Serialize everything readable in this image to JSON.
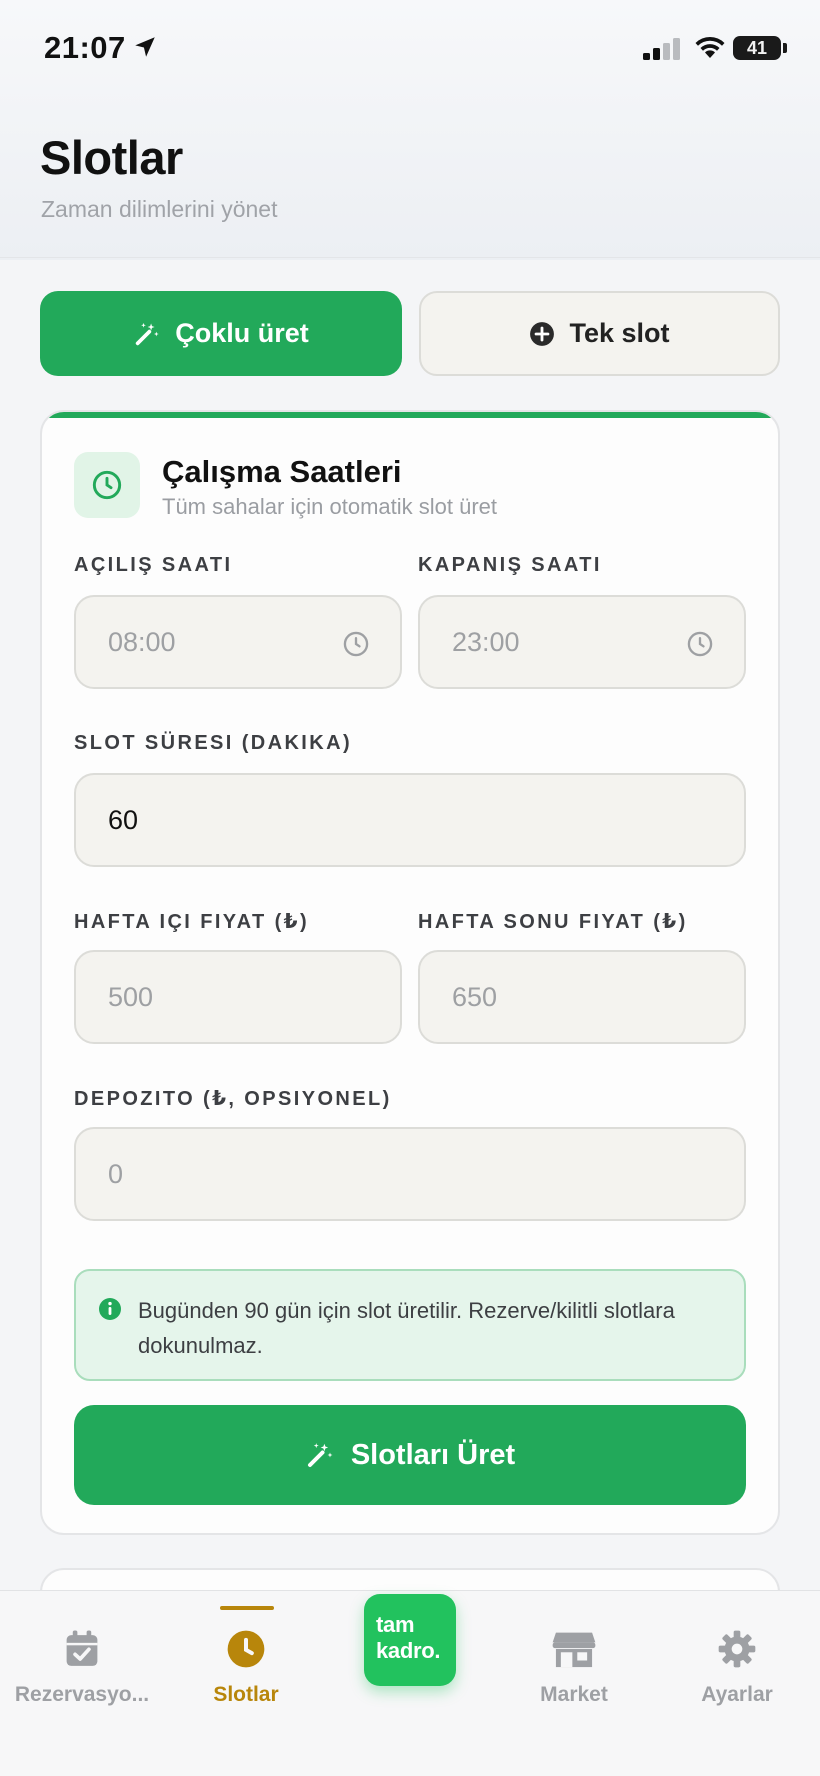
{
  "status_bar": {
    "time": "21:07",
    "battery": "41"
  },
  "header": {
    "title": "Slotlar",
    "subtitle": "Zaman dilimlerini yönet"
  },
  "mode_toggle": {
    "bulk_label": "Çoklu üret",
    "single_label": "Tek slot",
    "active": "bulk"
  },
  "card": {
    "title": "Çalışma Saatleri",
    "subtitle": "Tüm sahalar için otomatik slot üret",
    "opening": {
      "label": "AÇILIŞ SAATI",
      "placeholder": "08:00"
    },
    "closing": {
      "label": "KAPANIŞ SAATI",
      "placeholder": "23:00"
    },
    "slot_duration": {
      "label": "SLOT SÜRESI (DAKIKA)",
      "value": "60"
    },
    "weekday_price": {
      "label": "HAFTA IÇI FIYAT (₺)",
      "placeholder": "500"
    },
    "weekend_price": {
      "label": "HAFTA SONU FIYAT (₺)",
      "placeholder": "650"
    },
    "deposit": {
      "label": "DEPOZITO (₺, OPSIYONEL)",
      "placeholder": "0"
    },
    "info": "Bugünden 90 gün için slot üretilir. Rezerve/kilitli slotlara dokunulmaz.",
    "submit_label": "Slotları Üret"
  },
  "tabbar": {
    "items": [
      {
        "label": "Rezervasyo...",
        "icon": "calendar-check-icon"
      },
      {
        "label": "Slotlar",
        "icon": "clock-icon",
        "active": true
      },
      {
        "label": "Market",
        "icon": "store-icon"
      },
      {
        "label": "Ayarlar",
        "icon": "gear-icon"
      }
    ],
    "logo_line1": "tam",
    "logo_line2": "kadro."
  },
  "colors": {
    "primary": "#22a95a",
    "active_tab": "#b8860b",
    "info_bg": "#e5f5eb"
  }
}
